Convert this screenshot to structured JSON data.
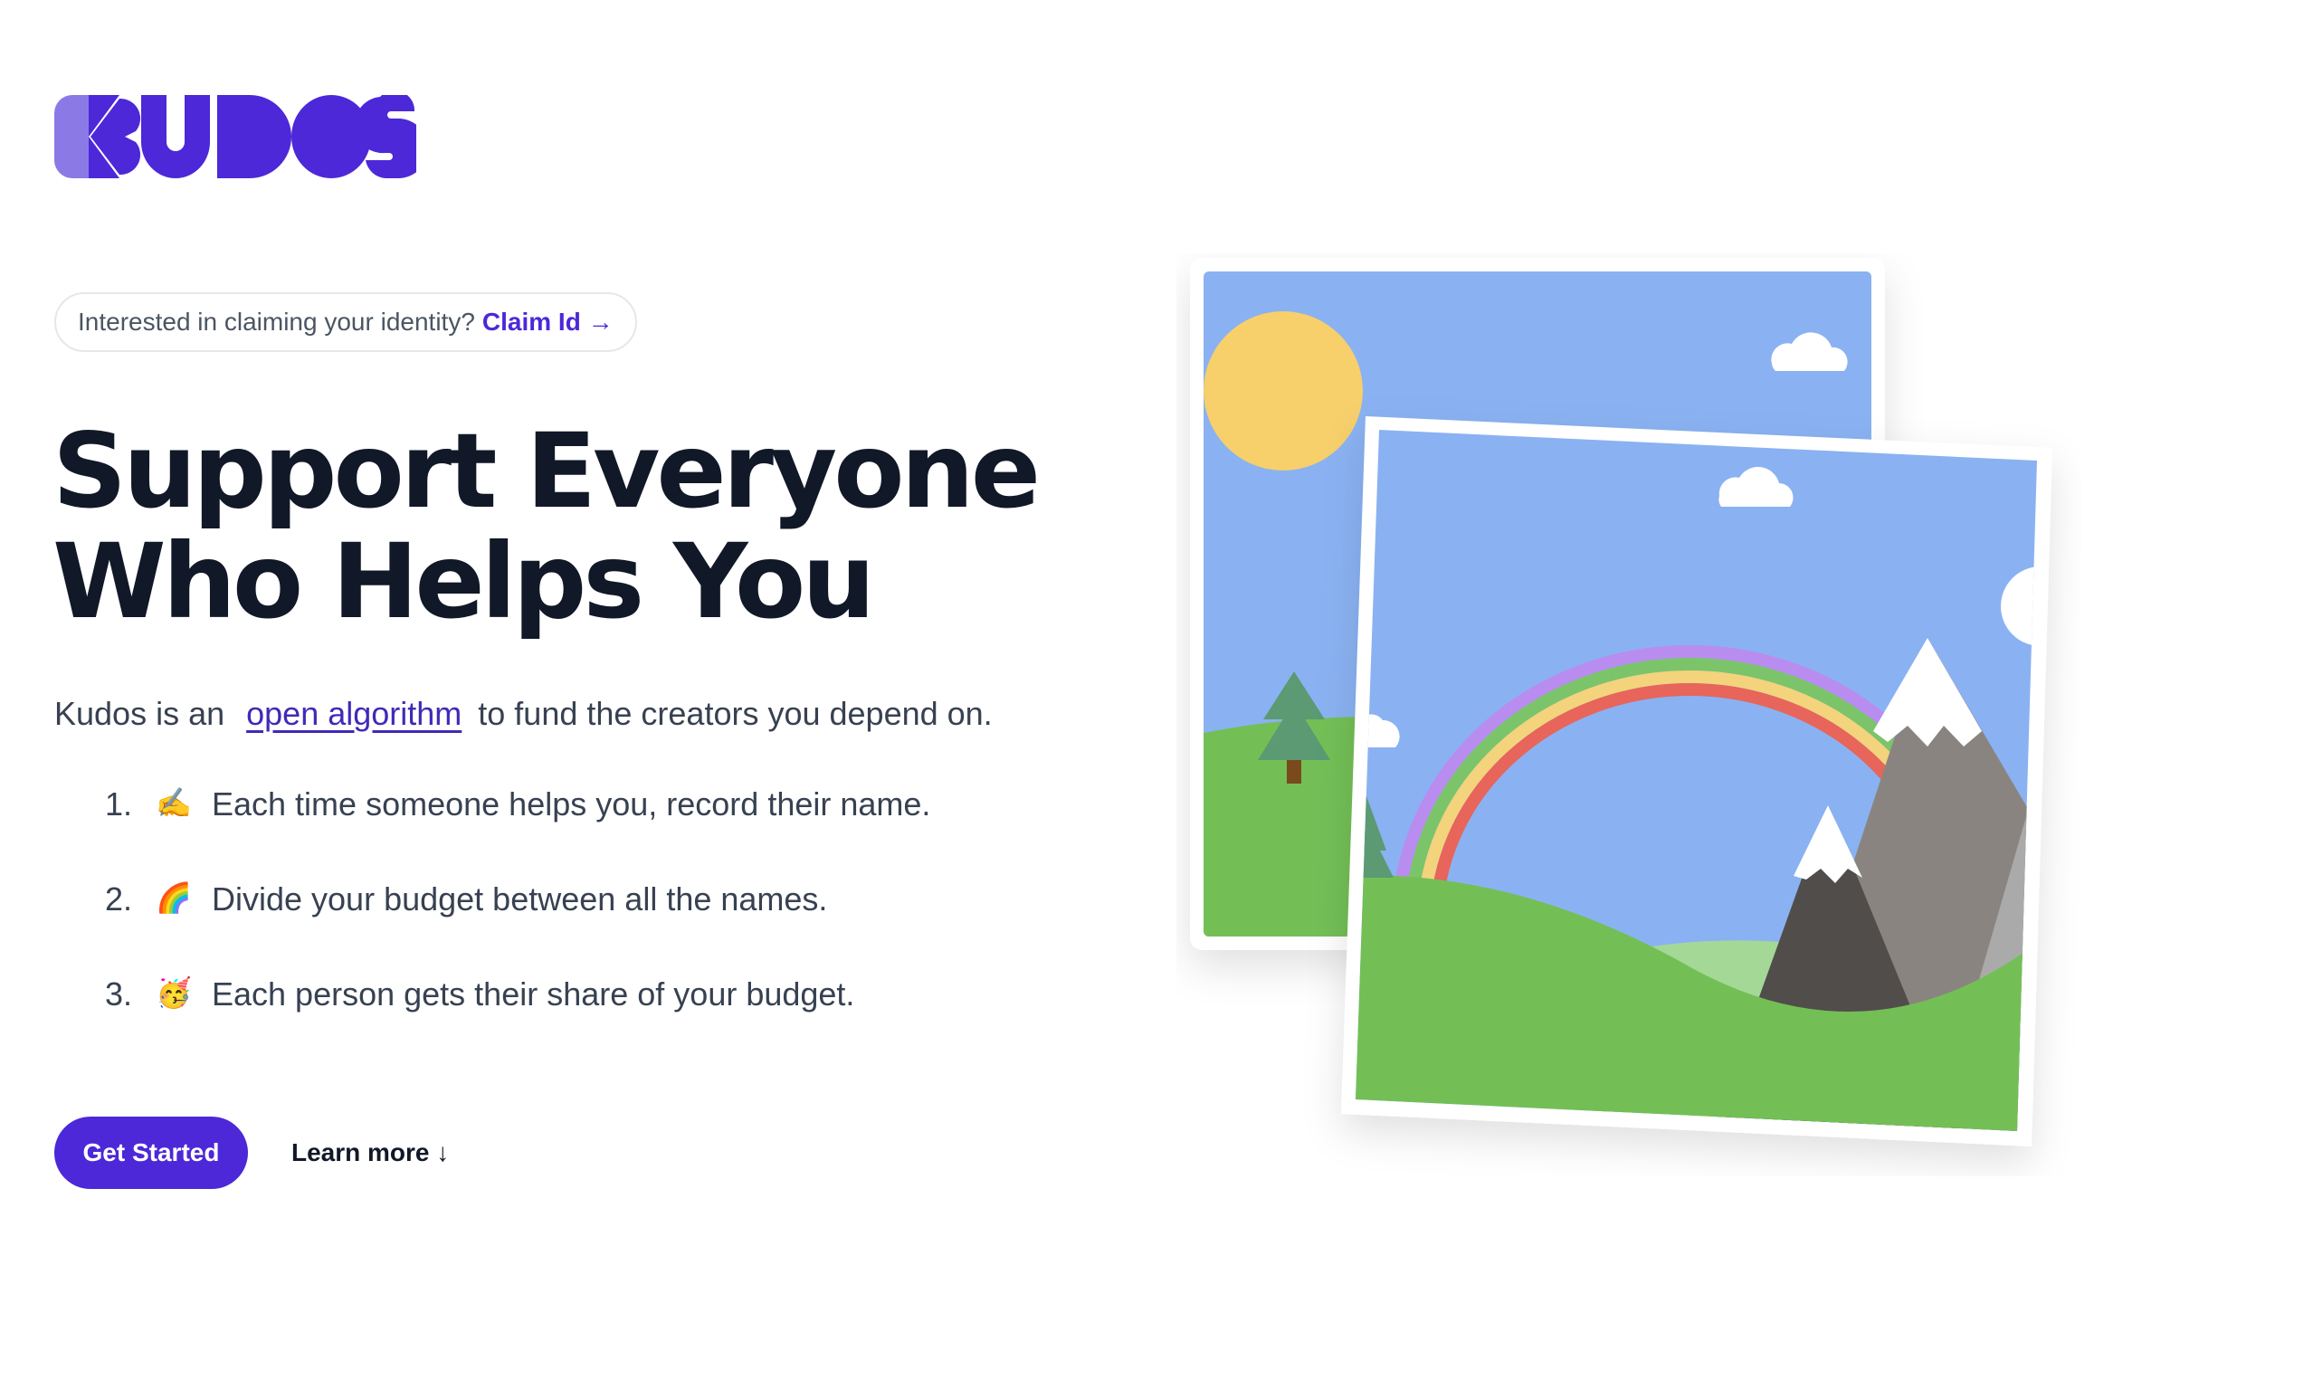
{
  "brand": {
    "name": "Kudos",
    "color": "#4c28d8",
    "logo_text": "KUDOS"
  },
  "banner": {
    "text": "Interested in claiming your identity?",
    "link_label": "Claim Id",
    "link_arrow": "→"
  },
  "hero": {
    "line1": "Support Everyone",
    "line2": "Who Helps You"
  },
  "intro": {
    "before": "Kudos is an",
    "link": "open algorithm",
    "after": "to fund the creators you depend on."
  },
  "steps": [
    {
      "number": "1.",
      "emoji": "✍️",
      "text": "Each time someone helps you, record their name."
    },
    {
      "number": "2.",
      "emoji": "🌈",
      "text": "Divide your budget between all the names."
    },
    {
      "number": "3.",
      "emoji": "🥳",
      "text": "Each person gets their share of your budget."
    }
  ],
  "actions": {
    "primary": "Get Started",
    "secondary": "Learn more",
    "secondary_icon": "↓"
  },
  "illustration": {
    "icon": "landscape-photo-stack",
    "colors": {
      "sky": "#8ab2f2",
      "sun": "#f7cf6b",
      "grass": "#73bf56",
      "mountain_dark": "#514d4a",
      "mountain_gray": "#8a8480",
      "snow": "#ffffff",
      "tree": "#5b9a72"
    }
  }
}
